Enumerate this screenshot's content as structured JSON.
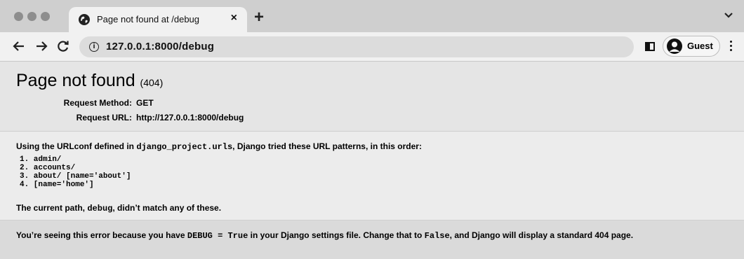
{
  "tab": {
    "title": "Page not found at /debug",
    "close": "×",
    "new_tab": "+"
  },
  "toolbar": {
    "url": "127.0.0.1:8000/debug",
    "info": "i",
    "profile_label": "Guest"
  },
  "summary": {
    "title": "Page not found",
    "status_code": "(404)",
    "request_method_label": "Request Method:",
    "request_method_value": "GET",
    "request_url_label": "Request URL:",
    "request_url_value": "http://127.0.0.1:8000/debug"
  },
  "info": {
    "urlconf_prefix": "Using the URLconf defined in ",
    "urlconf_module": "django_project.urls",
    "urlconf_suffix": ", Django tried these URL patterns, in this order:",
    "patterns": [
      "1. admin/",
      "2. accounts/",
      "3. about/ [name='about']",
      "4. [name='home']"
    ],
    "current_path_prefix": "The current path, ",
    "current_path": "debug",
    "current_path_suffix": ", didn’t match any of these."
  },
  "explanation": {
    "part1": "You’re seeing this error because you have ",
    "code1": "DEBUG = True",
    "part2": " in your Django settings file. Change that to ",
    "code2": "False",
    "part3": ", and Django will display a standard 404 page."
  }
}
